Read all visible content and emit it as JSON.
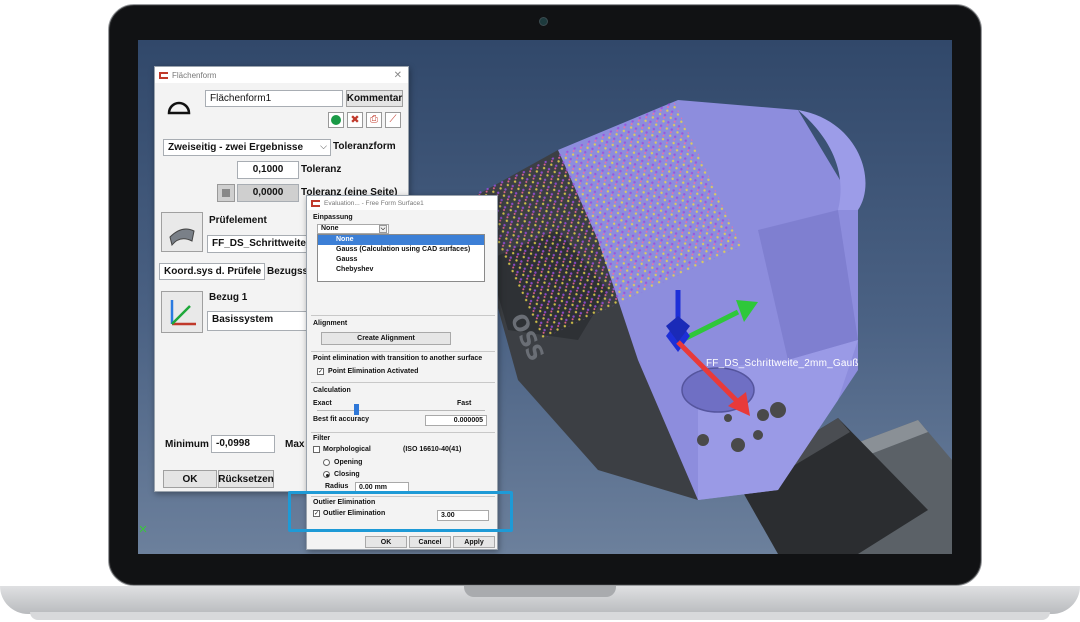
{
  "scene": {
    "axis_label": "FF_DS_Schrittweite_2mm_Gauß"
  },
  "flaechenform": {
    "title": "Flächenform",
    "name_value": "Flächenform1",
    "kommentar_label": "Kommentar",
    "mode_select": "Zweiseitig - zwei Ergebnisse",
    "toleranzform_label": "Toleranzform",
    "toleranz_value": "0,1000",
    "toleranz_label": "Toleranz",
    "toleranz_one_side_value": "0,0000",
    "toleranz_one_side_label": "Toleranz (eine Seite)",
    "pruefelement_label": "Prüfelement",
    "pruefelement_value": "FF_DS_Schrittweite_2",
    "koord_select": "Koord.sys d. Prüfele",
    "bezugs_label": "Bezugss",
    "bezug_label": "Bezug 1",
    "basissystem_value": "Basissystem",
    "minimum_label": "Minimum",
    "minimum_value": "-0,0998",
    "max_label": "Max",
    "ok_label": "OK",
    "reset_label": "Rücksetzen"
  },
  "evaluation": {
    "title": "Evaluation... - Free Form Surface1",
    "einpassung_label": "Einpassung",
    "fit_select": "None",
    "fit_options": [
      "None",
      "Gauss (Calculation using CAD surfaces)",
      "Gauss",
      "Chebyshev"
    ],
    "alignment_label": "Alignment",
    "create_alignment_label": "Create Alignment",
    "point_elim_label": "Point elimination with transition to another surface",
    "point_elim_activated_label": "Point Elimination Activated",
    "calculation_label": "Calculation",
    "exact_label": "Exact",
    "fast_label": "Fast",
    "best_fit_label": "Best fit accuracy",
    "best_fit_value": "0.000005",
    "filter_label": "Filter",
    "morphological_label": "Morphological",
    "iso_label": "(ISO 16610-40(41)",
    "opening_label": "Opening",
    "closing_label": "Closing",
    "radius_label": "Radius",
    "radius_value": "0.00 mm",
    "outlier_section_label": "Outlier Elimination",
    "outlier_check_label": "Outlier Elimination",
    "outlier_value": "3.00",
    "ok_label": "OK",
    "cancel_label": "Cancel",
    "apply_label": "Apply"
  },
  "colors": {
    "highlight": "#1e9ad6",
    "selected_option": "#3c7fd6",
    "part_surface": "#8f8fe0"
  }
}
